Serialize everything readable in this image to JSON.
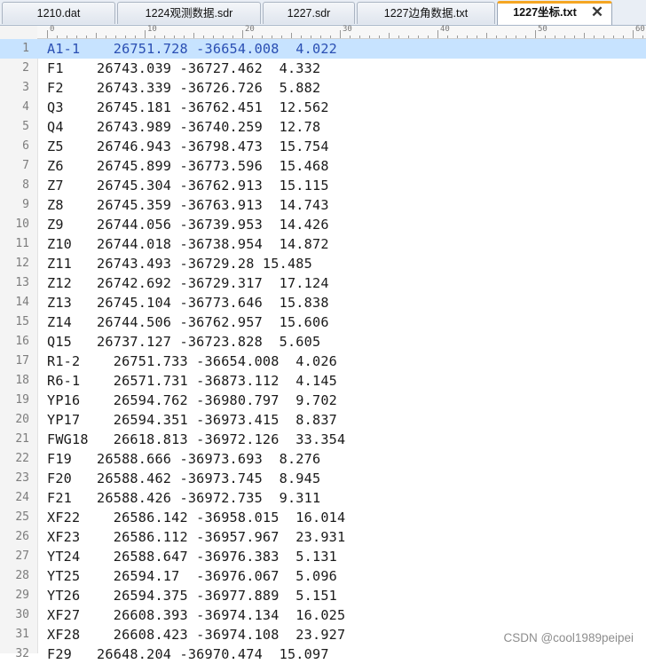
{
  "tabs": [
    {
      "label": "1210.dat",
      "active": false
    },
    {
      "label": "1224观测数据.sdr",
      "active": false
    },
    {
      "label": "1227.sdr",
      "active": false
    },
    {
      "label": "1227边角数据.txt",
      "active": false
    },
    {
      "label": "1227坐标.txt",
      "active": true
    }
  ],
  "close_glyph": "✕",
  "ruler_numbers": [
    "0",
    "10",
    "20",
    "30",
    "40",
    "50",
    "60"
  ],
  "lines": [
    {
      "n": "1",
      "text": "A1-1    26751.728 -36654.008  4.022",
      "current": true
    },
    {
      "n": "2",
      "text": "F1    26743.039 -36727.462  4.332"
    },
    {
      "n": "3",
      "text": "F2    26743.339 -36726.726  5.882"
    },
    {
      "n": "4",
      "text": "Q3    26745.181 -36762.451  12.562"
    },
    {
      "n": "5",
      "text": "Q4    26743.989 -36740.259  12.78"
    },
    {
      "n": "6",
      "text": "Z5    26746.943 -36798.473  15.754"
    },
    {
      "n": "7",
      "text": "Z6    26745.899 -36773.596  15.468"
    },
    {
      "n": "8",
      "text": "Z7    26745.304 -36762.913  15.115"
    },
    {
      "n": "9",
      "text": "Z8    26745.359 -36763.913  14.743"
    },
    {
      "n": "10",
      "text": "Z9    26744.056 -36739.953  14.426"
    },
    {
      "n": "11",
      "text": "Z10   26744.018 -36738.954  14.872"
    },
    {
      "n": "12",
      "text": "Z11   26743.493 -36729.28 15.485"
    },
    {
      "n": "13",
      "text": "Z12   26742.692 -36729.317  17.124"
    },
    {
      "n": "14",
      "text": "Z13   26745.104 -36773.646  15.838"
    },
    {
      "n": "15",
      "text": "Z14   26744.506 -36762.957  15.606"
    },
    {
      "n": "16",
      "text": "Q15   26737.127 -36723.828  5.605"
    },
    {
      "n": "17",
      "text": "R1-2    26751.733 -36654.008  4.026"
    },
    {
      "n": "18",
      "text": "R6-1    26571.731 -36873.112  4.145"
    },
    {
      "n": "19",
      "text": "YP16    26594.762 -36980.797  9.702"
    },
    {
      "n": "20",
      "text": "YP17    26594.351 -36973.415  8.837"
    },
    {
      "n": "21",
      "text": "FWG18   26618.813 -36972.126  33.354"
    },
    {
      "n": "22",
      "text": "F19   26588.666 -36973.693  8.276"
    },
    {
      "n": "23",
      "text": "F20   26588.462 -36973.745  8.945"
    },
    {
      "n": "24",
      "text": "F21   26588.426 -36972.735  9.311"
    },
    {
      "n": "25",
      "text": "XF22    26586.142 -36958.015  16.014"
    },
    {
      "n": "26",
      "text": "XF23    26586.112 -36957.967  23.931"
    },
    {
      "n": "27",
      "text": "YT24    26588.647 -36976.383  5.131"
    },
    {
      "n": "28",
      "text": "YT25    26594.17  -36976.067  5.096"
    },
    {
      "n": "29",
      "text": "YT26    26594.375 -36977.889  5.151"
    },
    {
      "n": "30",
      "text": "XF27    26608.393 -36974.134  16.025"
    },
    {
      "n": "31",
      "text": "XF28    26608.423 -36974.108  23.927"
    },
    {
      "n": "32",
      "text": "F29   26648.204 -36970.474  15.097"
    }
  ],
  "watermark": "CSDN @cool1989peipei",
  "colors": {
    "active_tab_accent": "#f5a623",
    "current_line": "#c7e3ff",
    "current_line_text": "#2a4fb3"
  }
}
